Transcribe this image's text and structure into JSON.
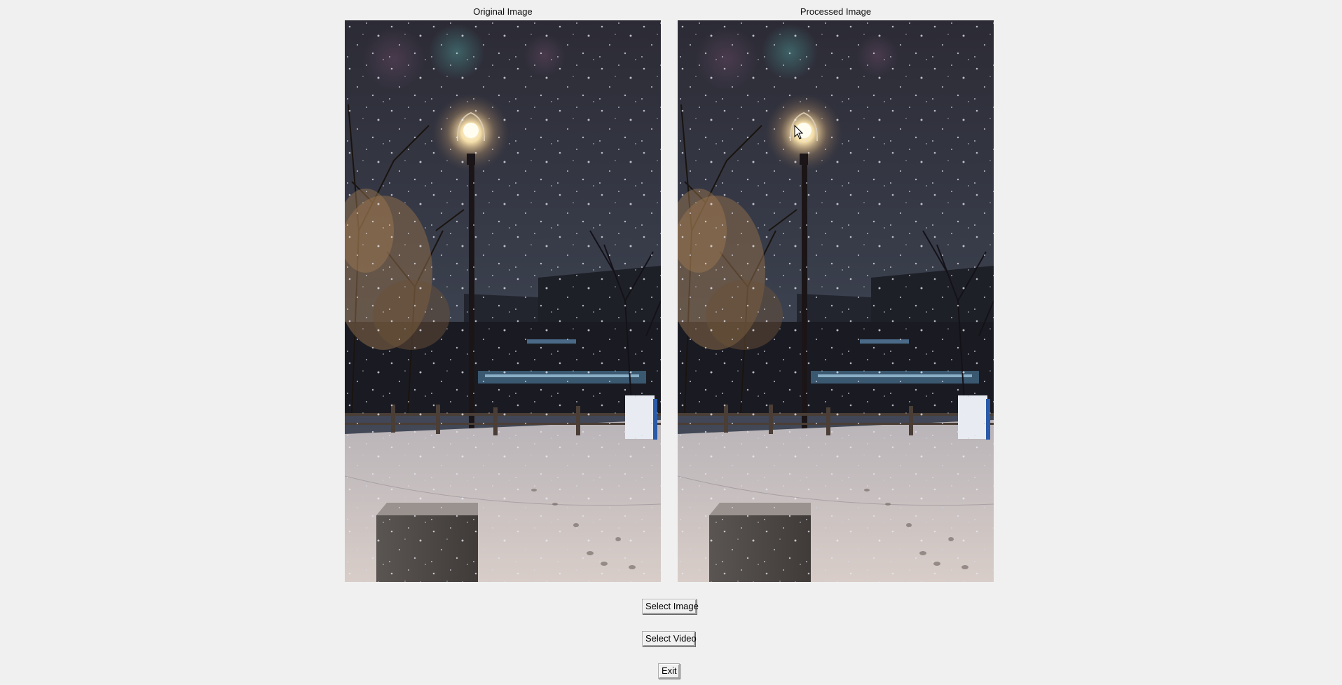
{
  "panels": {
    "original_title": "Original Image",
    "processed_title": "Processed Image"
  },
  "buttons": {
    "select_image": "Select Image",
    "select_video": "Select Video",
    "exit": "Exit"
  }
}
